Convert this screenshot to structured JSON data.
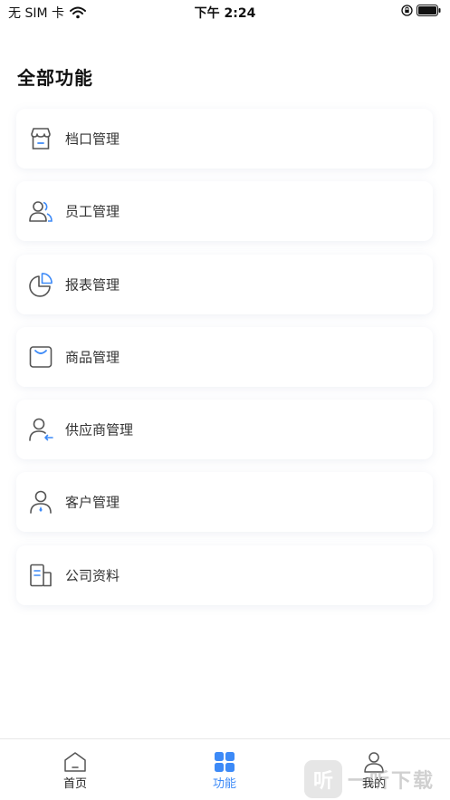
{
  "status_bar": {
    "carrier": "无 SIM 卡",
    "time": "下午 2:24"
  },
  "page_title": "全部功能",
  "menu": [
    {
      "label": "档口管理",
      "icon": "store-icon"
    },
    {
      "label": "员工管理",
      "icon": "staff-icon"
    },
    {
      "label": "报表管理",
      "icon": "pie-chart-icon"
    },
    {
      "label": "商品管理",
      "icon": "shopping-bag-icon"
    },
    {
      "label": "供应商管理",
      "icon": "supplier-icon"
    },
    {
      "label": "客户管理",
      "icon": "customer-icon"
    },
    {
      "label": "公司资料",
      "icon": "company-doc-icon"
    }
  ],
  "tabs": [
    {
      "label": "首页",
      "icon": "home-icon",
      "active": false
    },
    {
      "label": "功能",
      "icon": "grid-icon",
      "active": true
    },
    {
      "label": "我的",
      "icon": "user-icon",
      "active": false
    }
  ],
  "watermark": {
    "logo_char": "听",
    "text": "一听下载"
  },
  "colors": {
    "accent": "#3d8af7",
    "icon_stroke": "#555555",
    "card_bg": "#ffffff"
  }
}
